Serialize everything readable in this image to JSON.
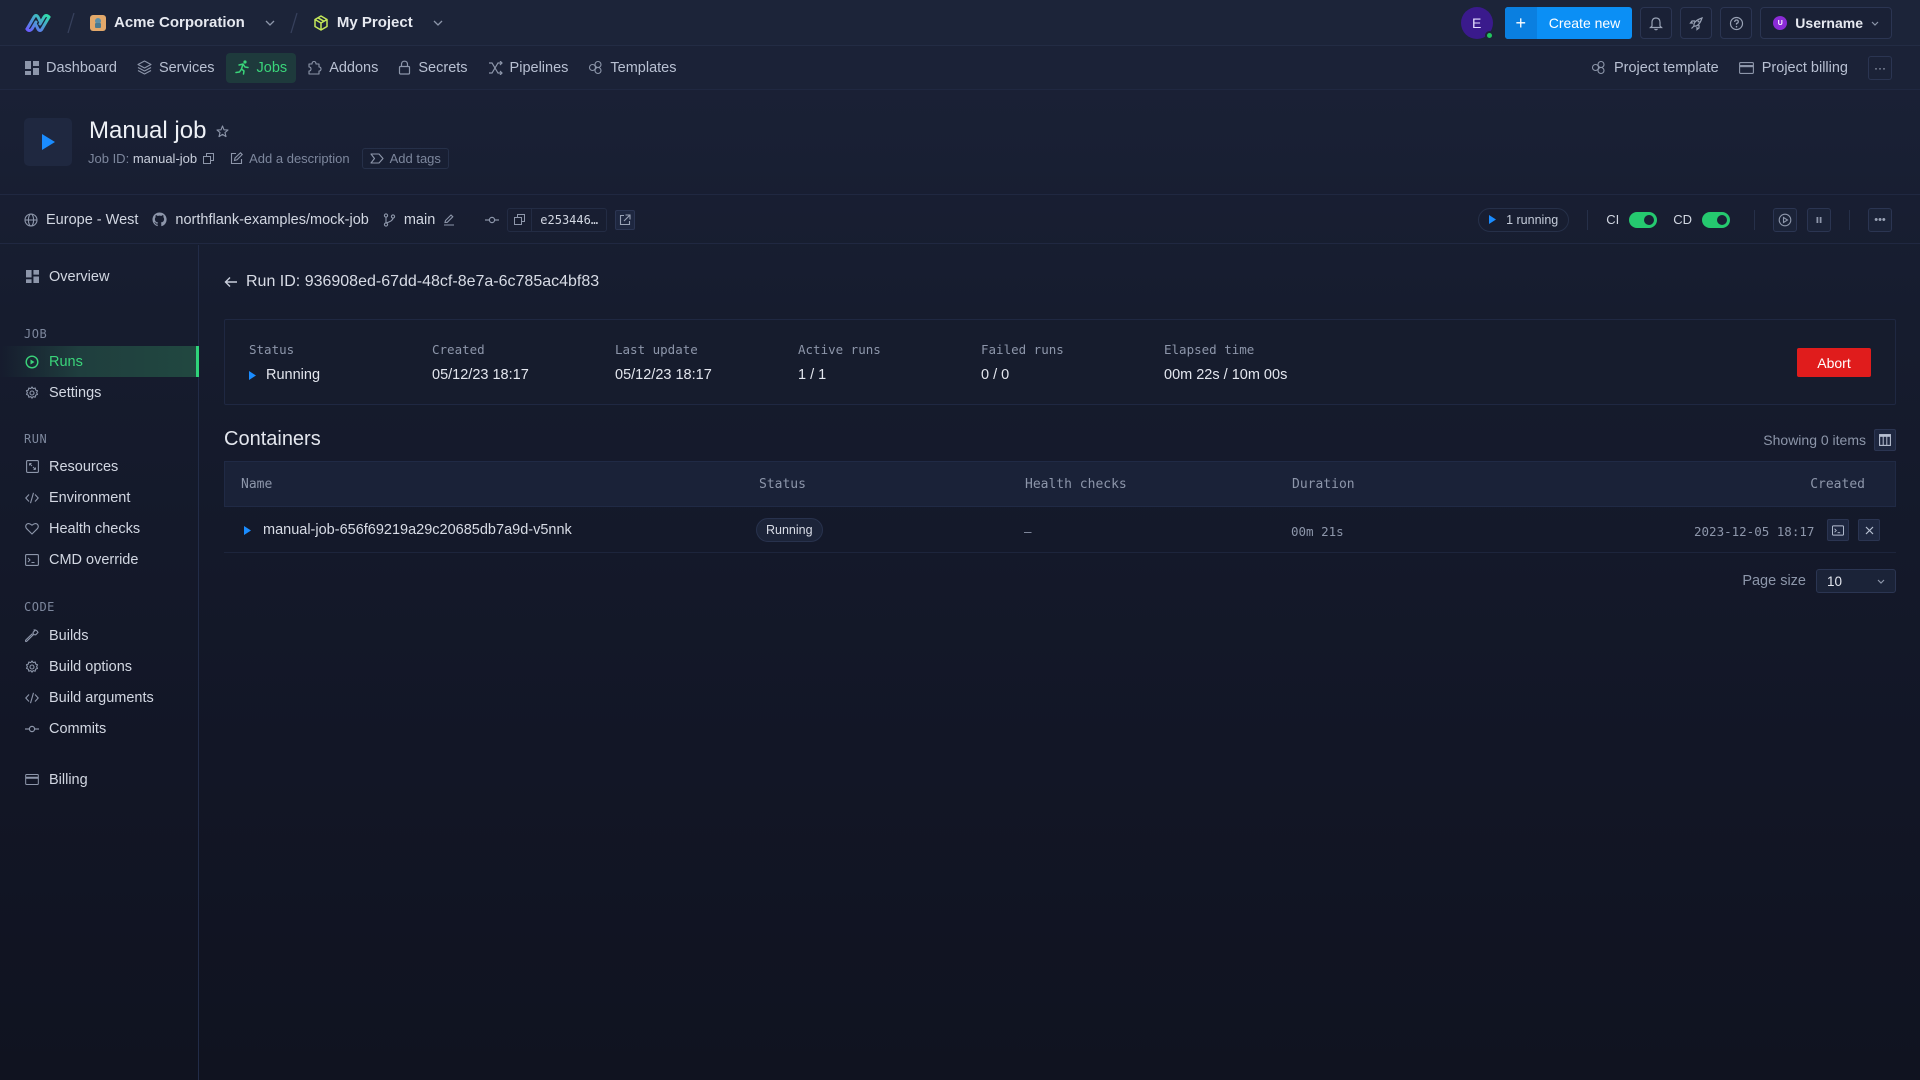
{
  "topbar": {
    "org_name": "Acme Corporation",
    "project_name": "My Project",
    "avatar_initial": "E",
    "create_new_label": "Create new",
    "user_initial": "U",
    "username": "Username",
    "icons": [
      "northflank-logo-icon",
      "bell-icon",
      "rocket-icon",
      "help-icon"
    ]
  },
  "nav": {
    "items": [
      {
        "label": "Dashboard",
        "icon": "dashboard-icon"
      },
      {
        "label": "Services",
        "icon": "layers-icon"
      },
      {
        "label": "Jobs",
        "icon": "running-icon",
        "active": true
      },
      {
        "label": "Addons",
        "icon": "puzzle-icon"
      },
      {
        "label": "Secrets",
        "icon": "lock-icon"
      },
      {
        "label": "Pipelines",
        "icon": "shuffle-icon"
      },
      {
        "label": "Templates",
        "icon": "template-icon"
      }
    ],
    "right": [
      {
        "label": "Project template",
        "icon": "template-icon"
      },
      {
        "label": "Project billing",
        "icon": "credit-card-icon"
      }
    ]
  },
  "header": {
    "title": "Manual job",
    "job_id_label": "Job ID:",
    "job_id": "manual-job",
    "add_description": "Add a description",
    "add_tags": "Add tags"
  },
  "infobar": {
    "region": "Europe - West",
    "repo": "northflank-examples/mock-job",
    "branch": "main",
    "commit_sha": "e253446…",
    "running_label": "1 running",
    "ci_label": "CI",
    "ci_enabled": true,
    "cd_label": "CD",
    "cd_enabled": true
  },
  "sidebar": {
    "overview": "Overview",
    "sections": [
      {
        "title": "JOB",
        "items": [
          {
            "label": "Runs",
            "icon": "play-circle-icon",
            "active": true
          },
          {
            "label": "Settings",
            "icon": "gear-icon"
          }
        ]
      },
      {
        "title": "RUN",
        "items": [
          {
            "label": "Resources",
            "icon": "resources-icon"
          },
          {
            "label": "Environment",
            "icon": "code-icon"
          },
          {
            "label": "Health checks",
            "icon": "heart-icon"
          },
          {
            "label": "CMD override",
            "icon": "terminal-icon"
          }
        ]
      },
      {
        "title": "CODE",
        "items": [
          {
            "label": "Builds",
            "icon": "wrench-icon"
          },
          {
            "label": "Build options",
            "icon": "gear-icon"
          },
          {
            "label": "Build arguments",
            "icon": "code-icon"
          },
          {
            "label": "Commits",
            "icon": "commit-icon"
          }
        ]
      }
    ],
    "billing": "Billing"
  },
  "run": {
    "run_id_label": "Run ID: 936908ed-67dd-48cf-8e7a-6c785ac4bf83",
    "summary": [
      {
        "label": "Status",
        "value": "Running"
      },
      {
        "label": "Created",
        "value": "05/12/23 18:17"
      },
      {
        "label": "Last update",
        "value": "05/12/23 18:17"
      },
      {
        "label": "Active runs",
        "value": "1 / 1"
      },
      {
        "label": "Failed runs",
        "value": "0 / 0"
      },
      {
        "label": "Elapsed time",
        "value": "00m 22s / 10m 00s"
      }
    ],
    "abort_label": "Abort"
  },
  "containers": {
    "title": "Containers",
    "showing": "Showing 0 items",
    "columns": [
      "Name",
      "Status",
      "Health checks",
      "Duration",
      "Created"
    ],
    "rows": [
      {
        "name": "manual-job-656f69219a29c20685db7a9d-v5nnk",
        "status": "Running",
        "health_checks": "—",
        "duration": "00m 21s",
        "created": "2023-12-05 18:17"
      }
    ],
    "page_size_label": "Page size",
    "page_size": "10"
  },
  "colors": {
    "accent_green": "#3ad47a",
    "accent_blue": "#0b8ff5",
    "danger": "#e01c1c"
  }
}
